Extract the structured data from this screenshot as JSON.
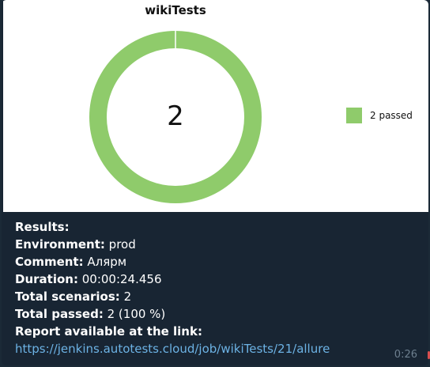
{
  "chart": {
    "title": "wikiTests",
    "center_value": "2",
    "legend_label": "2 passed",
    "passed_color": "#8fcb6b"
  },
  "chart_data": {
    "type": "pie",
    "title": "wikiTests",
    "categories": [
      "passed"
    ],
    "values": [
      2
    ],
    "legend": [
      "2 passed"
    ],
    "legend_position": "right",
    "center_label": "2"
  },
  "message": {
    "results_label": "Results:",
    "environment_label": "Environment:",
    "environment_value": "prod",
    "comment_label": "Comment:",
    "comment_value": "Алярм",
    "duration_label": "Duration:",
    "duration_value": "00:00:24.456",
    "total_scenarios_label": "Total scenarios:",
    "total_scenarios_value": "2",
    "total_passed_label": "Total passed:",
    "total_passed_value": "2 (100 %)",
    "report_label": "Report available at the link:",
    "report_link": "https://jenkins.autotests.cloud/job/wikiTests/21/allure",
    "time": "0:26"
  }
}
